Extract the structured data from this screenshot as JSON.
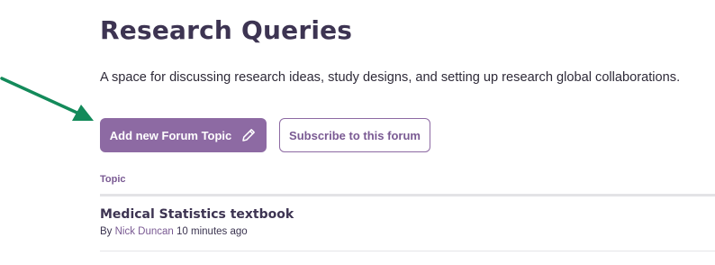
{
  "page": {
    "title": "Research Queries",
    "description": "A space for discussing research ideas, study designs, and setting up research global collaborations."
  },
  "actions": {
    "add_topic_label": "Add new Forum Topic",
    "add_topic_icon": "pencil-icon",
    "subscribe_label": "Subscribe to this forum"
  },
  "annotation": {
    "arrow_icon": "arrow-icon",
    "arrow_color": "#138a5a"
  },
  "table": {
    "column_header": "Topic",
    "rows": [
      {
        "title": "Medical Statistics textbook",
        "by_label": "By",
        "author": "Nick Duncan",
        "time": "10 minutes ago"
      }
    ]
  },
  "colors": {
    "primary": "#8d6aa3",
    "heading": "#3d3452",
    "link": "#7a5a93"
  }
}
